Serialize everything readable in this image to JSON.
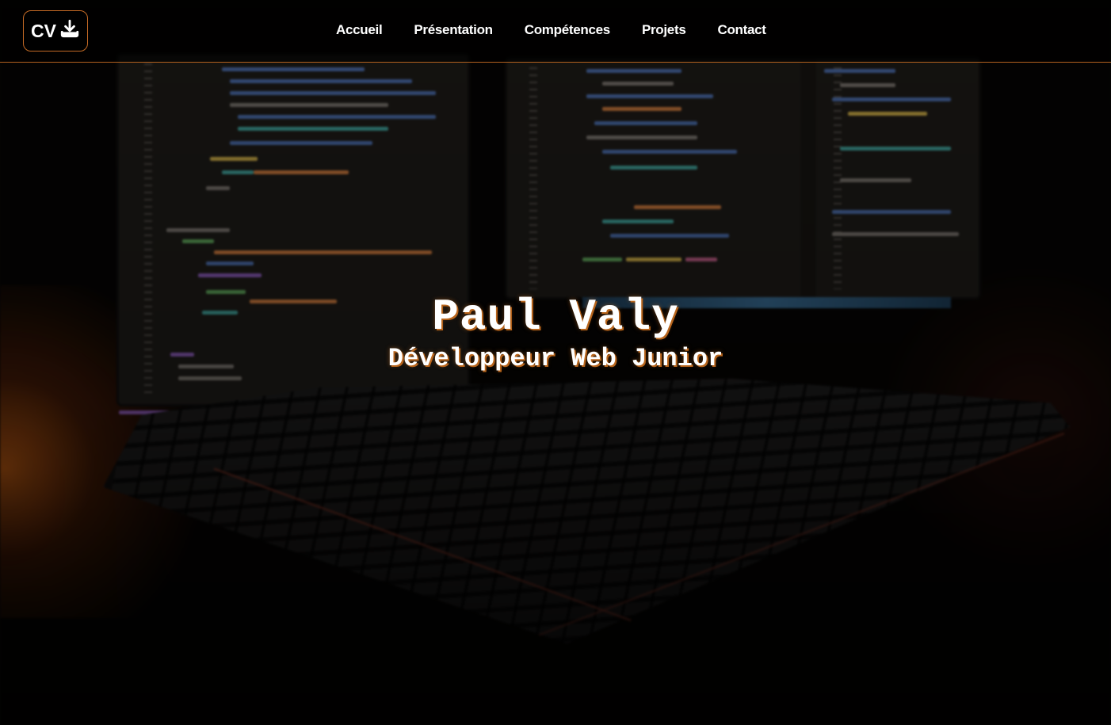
{
  "navbar": {
    "cv_label": "CV",
    "cv_icon": "download-icon",
    "links": [
      {
        "label": "Accueil"
      },
      {
        "label": "Présentation"
      },
      {
        "label": "Compétences"
      },
      {
        "label": "Projets"
      },
      {
        "label": "Contact"
      }
    ]
  },
  "hero": {
    "name": "Paul Valy",
    "role": "Développeur Web Junior",
    "background": "desk-with-monitors-and-keyboard-image"
  },
  "colors": {
    "accent": "#c46a25",
    "text": "#ffffff",
    "background": "#050403"
  }
}
